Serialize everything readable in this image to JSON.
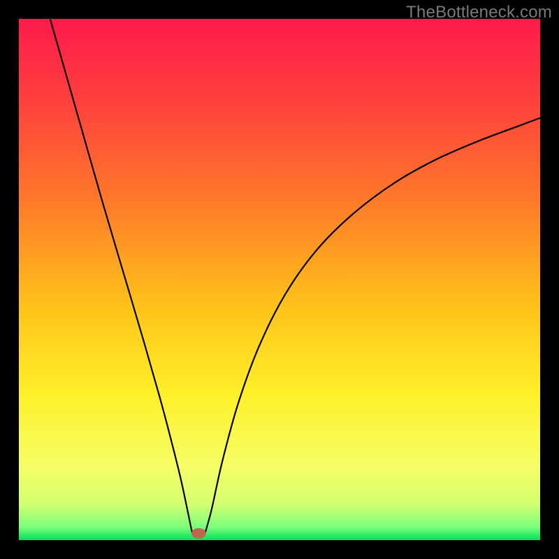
{
  "watermark": "TheBottleneck.com",
  "chart_data": {
    "type": "line",
    "title": "",
    "xlabel": "",
    "ylabel": "",
    "xlim": [
      0,
      100
    ],
    "ylim": [
      0,
      100
    ],
    "grid": false,
    "legend": false,
    "background_gradient_stops": [
      {
        "offset": 0.0,
        "color": "#ff1a4b"
      },
      {
        "offset": 0.15,
        "color": "#ff3e3e"
      },
      {
        "offset": 0.35,
        "color": "#ff7a2a"
      },
      {
        "offset": 0.55,
        "color": "#ffc21a"
      },
      {
        "offset": 0.72,
        "color": "#fff02a"
      },
      {
        "offset": 0.86,
        "color": "#f6ff66"
      },
      {
        "offset": 0.93,
        "color": "#d4ff70"
      },
      {
        "offset": 0.975,
        "color": "#7dff7d"
      },
      {
        "offset": 1.0,
        "color": "#00e05a"
      }
    ],
    "marker": {
      "x": 34.5,
      "y": 1.3,
      "color": "#c0654e",
      "rx": 1.4,
      "ry": 1.0
    },
    "series": [
      {
        "name": "left-branch",
        "points": [
          {
            "x": 6.0,
            "y": 100.0
          },
          {
            "x": 8.0,
            "y": 93.0
          },
          {
            "x": 12.0,
            "y": 79.0
          },
          {
            "x": 16.0,
            "y": 65.0
          },
          {
            "x": 20.0,
            "y": 51.5
          },
          {
            "x": 24.0,
            "y": 38.0
          },
          {
            "x": 27.0,
            "y": 27.5
          },
          {
            "x": 29.0,
            "y": 20.0
          },
          {
            "x": 31.0,
            "y": 12.0
          },
          {
            "x": 32.5,
            "y": 5.0
          },
          {
            "x": 33.2,
            "y": 1.6
          }
        ]
      },
      {
        "name": "flat-segment",
        "points": [
          {
            "x": 33.2,
            "y": 1.6
          },
          {
            "x": 35.8,
            "y": 1.6
          }
        ]
      },
      {
        "name": "right-branch",
        "points": [
          {
            "x": 35.8,
            "y": 1.6
          },
          {
            "x": 37.0,
            "y": 6.0
          },
          {
            "x": 39.0,
            "y": 15.0
          },
          {
            "x": 42.0,
            "y": 26.0
          },
          {
            "x": 46.0,
            "y": 37.0
          },
          {
            "x": 51.0,
            "y": 47.0
          },
          {
            "x": 57.0,
            "y": 55.5
          },
          {
            "x": 64.0,
            "y": 62.5
          },
          {
            "x": 72.0,
            "y": 68.5
          },
          {
            "x": 80.0,
            "y": 73.0
          },
          {
            "x": 88.0,
            "y": 76.5
          },
          {
            "x": 96.0,
            "y": 79.5
          },
          {
            "x": 100.0,
            "y": 81.0
          }
        ]
      }
    ]
  }
}
